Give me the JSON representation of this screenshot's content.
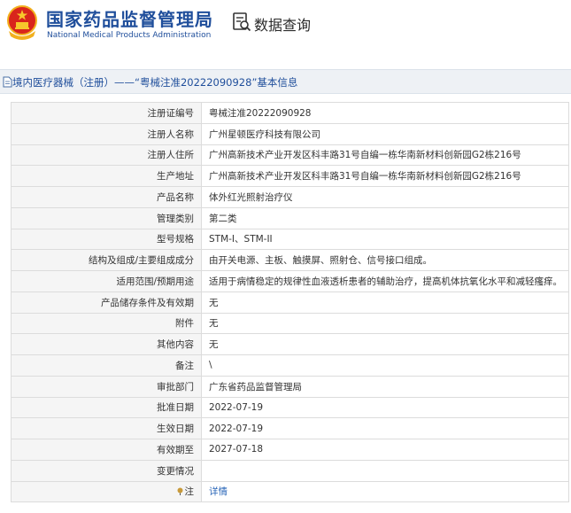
{
  "header": {
    "agency_name_cn": "国家药品监督管理局",
    "agency_name_en": "National Medical Products Administration",
    "query_title": "数据查询",
    "emblem_icon": "national-emblem-icon",
    "query_icon": "document-search-icon"
  },
  "breadcrumb": {
    "text": "境内医疗器械（注册）——“粤械注准20222090928”基本信息"
  },
  "rows": [
    {
      "label": "注册证编号",
      "value": "粤械注准20222090928"
    },
    {
      "label": "注册人名称",
      "value": "广州星顿医疗科技有限公司"
    },
    {
      "label": "注册人住所",
      "value": "广州高新技术产业开发区科丰路31号自编一栋华南新材料创新园G2栋216号"
    },
    {
      "label": "生产地址",
      "value": "广州高新技术产业开发区科丰路31号自编一栋华南新材料创新园G2栋216号"
    },
    {
      "label": "产品名称",
      "value": "体外红光照射治疗仪"
    },
    {
      "label": "管理类别",
      "value": "第二类"
    },
    {
      "label": "型号规格",
      "value": "STM-I、STM-II"
    },
    {
      "label": "结构及组成/主要组成成分",
      "value": "由开关电源、主板、触摸屏、照射仓、信号接口组成。"
    },
    {
      "label": "适用范围/预期用途",
      "value": "适用于病情稳定的规律性血液透析患者的辅助治疗，提高机体抗氧化水平和减轻瘙痒。"
    },
    {
      "label": "产品储存条件及有效期",
      "value": "无"
    },
    {
      "label": "附件",
      "value": "无"
    },
    {
      "label": "其他内容",
      "value": "无"
    },
    {
      "label": "备注",
      "value": "\\"
    },
    {
      "label": "审批部门",
      "value": "广东省药品监督管理局"
    },
    {
      "label": "批准日期",
      "value": "2022-07-19"
    },
    {
      "label": "生效日期",
      "value": "2022-07-19"
    },
    {
      "label": "有效期至",
      "value": "2027-07-18"
    },
    {
      "label": "变更情况",
      "value": ""
    }
  ],
  "note_row": {
    "label": "注",
    "link_text": "详情"
  },
  "colors": {
    "brand_blue": "#1f4e9b",
    "link_blue": "#2a66b8",
    "label_bg": "#f5f5f5",
    "title_bar_bg": "#eef1f5"
  }
}
